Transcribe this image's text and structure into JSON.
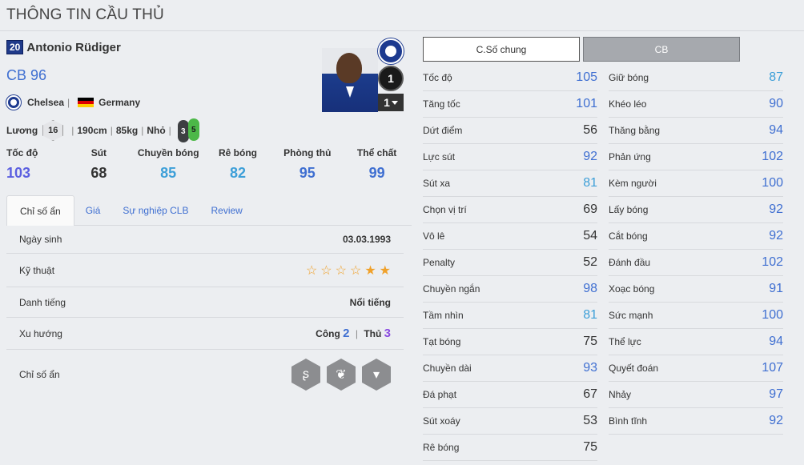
{
  "page_title": "THÔNG TIN CẦU THỦ",
  "player": {
    "season_number": "20",
    "name": "Antonio Rüdiger",
    "position_ovr": "CB 96",
    "club": "Chelsea",
    "nation": "Germany",
    "salary_label": "Lương",
    "salary": "16",
    "height": "190cm",
    "weight": "85kg",
    "body": "Nhỏ",
    "left_foot": "3",
    "right_foot": "5",
    "upgrade_level": "1",
    "upgrade_select": "1"
  },
  "summary": [
    {
      "label": "Tốc độ",
      "value": "103",
      "color": "#5b5fe0"
    },
    {
      "label": "Sút",
      "value": "68",
      "color": "#333333"
    },
    {
      "label": "Chuyền bóng",
      "value": "85",
      "color": "#3d9fd8"
    },
    {
      "label": "Rê bóng",
      "value": "82",
      "color": "#3d9fd8"
    },
    {
      "label": "Phòng thủ",
      "value": "95",
      "color": "#3f6fd1"
    },
    {
      "label": "Thể chất",
      "value": "99",
      "color": "#3f6fd1"
    }
  ],
  "tabs": [
    "Chỉ số ẩn",
    "Giá",
    "Sự nghiệp CLB",
    "Review"
  ],
  "details": {
    "birth_label": "Ngày sinh",
    "birth_value": "03.03.1993",
    "skill_label": "Kỹ thuật",
    "skill_stars": 2,
    "fame_label": "Danh tiếng",
    "fame_value": "Nổi tiếng",
    "trend_label": "Xu hướng",
    "attack_label": "Công",
    "attack_value": "2",
    "defense_label": "Thủ",
    "defense_value": "3",
    "hidden_label": "Chỉ số ẩn",
    "hidden_icons": [
      "snake-icon",
      "paw-icon",
      "tie-ball-icon"
    ]
  },
  "buttons": {
    "general": "C.Số chung",
    "position": "CB"
  },
  "stats_left": [
    {
      "label": "Tốc độ",
      "value": "105",
      "color": "#3f6fd1"
    },
    {
      "label": "Tăng tốc",
      "value": "101",
      "color": "#3f6fd1"
    },
    {
      "label": "Dứt điểm",
      "value": "56",
      "color": "#333333"
    },
    {
      "label": "Lực sút",
      "value": "92",
      "color": "#3f6fd1"
    },
    {
      "label": "Sút xa",
      "value": "81",
      "color": "#3d9fd8"
    },
    {
      "label": "Chọn vị trí",
      "value": "69",
      "color": "#333333"
    },
    {
      "label": "Vô lê",
      "value": "54",
      "color": "#333333"
    },
    {
      "label": "Penalty",
      "value": "52",
      "color": "#333333"
    },
    {
      "label": "Chuyền ngắn",
      "value": "98",
      "color": "#3f6fd1"
    },
    {
      "label": "Tầm nhìn",
      "value": "81",
      "color": "#3d9fd8"
    },
    {
      "label": "Tạt bóng",
      "value": "75",
      "color": "#333333"
    },
    {
      "label": "Chuyền dài",
      "value": "93",
      "color": "#3f6fd1"
    },
    {
      "label": "Đá phạt",
      "value": "67",
      "color": "#333333"
    },
    {
      "label": "Sút xoáy",
      "value": "53",
      "color": "#333333"
    },
    {
      "label": "Rê bóng",
      "value": "75",
      "color": "#333333"
    }
  ],
  "stats_right": [
    {
      "label": "Giữ bóng",
      "value": "87",
      "color": "#3d9fd8"
    },
    {
      "label": "Khéo léo",
      "value": "90",
      "color": "#3f6fd1"
    },
    {
      "label": "Thăng bằng",
      "value": "94",
      "color": "#3f6fd1"
    },
    {
      "label": "Phản ứng",
      "value": "102",
      "color": "#3f6fd1"
    },
    {
      "label": "Kèm người",
      "value": "100",
      "color": "#3f6fd1"
    },
    {
      "label": "Lấy bóng",
      "value": "92",
      "color": "#3f6fd1"
    },
    {
      "label": "Cắt bóng",
      "value": "92",
      "color": "#3f6fd1"
    },
    {
      "label": "Đánh đầu",
      "value": "102",
      "color": "#3f6fd1"
    },
    {
      "label": "Xoạc bóng",
      "value": "91",
      "color": "#3f6fd1"
    },
    {
      "label": "Sức mạnh",
      "value": "100",
      "color": "#3f6fd1"
    },
    {
      "label": "Thể lực",
      "value": "94",
      "color": "#3f6fd1"
    },
    {
      "label": "Quyết đoán",
      "value": "107",
      "color": "#3f6fd1"
    },
    {
      "label": "Nhảy",
      "value": "97",
      "color": "#3f6fd1"
    },
    {
      "label": "Bình tĩnh",
      "value": "92",
      "color": "#3f6fd1"
    }
  ]
}
